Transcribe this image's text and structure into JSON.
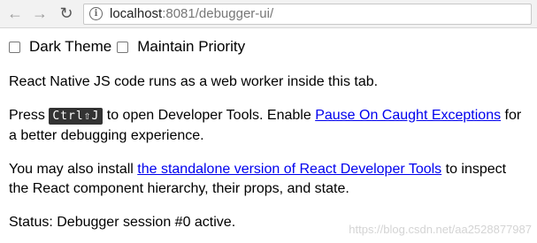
{
  "browser": {
    "url_host": "localhost",
    "url_rest": ":8081/debugger-ui/"
  },
  "toggles": [
    {
      "label": "Dark Theme",
      "checked": false
    },
    {
      "label": "Maintain Priority",
      "checked": false
    }
  ],
  "content": {
    "intro": "React Native JS code runs as a web worker inside this tab.",
    "press_prefix": "Press ",
    "shortcut": "Ctrl⇧J",
    "press_middle": " to open Developer Tools. Enable ",
    "pause_link": "Pause On Caught Exceptions",
    "press_suffix": " for a better debugging experience.",
    "install_prefix": "You may also install ",
    "devtools_link": "the standalone version of React Developer Tools",
    "install_suffix": " to inspect the React component hierarchy, their props, and state.",
    "status": "Status: Debugger session #0 active."
  },
  "watermark": "https://blog.csdn.net/aa2528877987",
  "colors": {
    "link": "#0000ee",
    "kbd_bg": "#333333"
  }
}
